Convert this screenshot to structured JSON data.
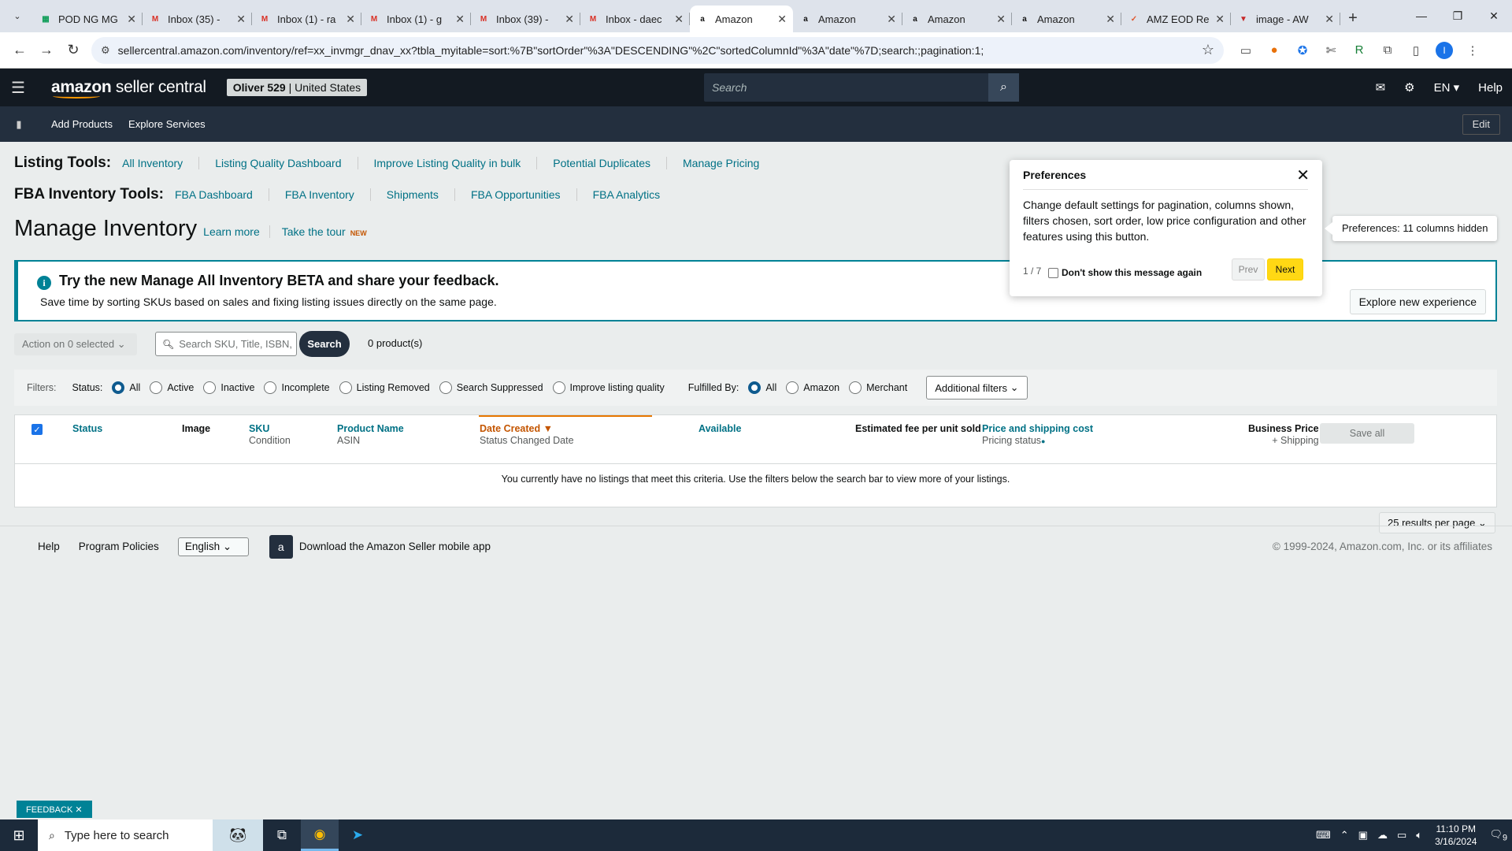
{
  "browser": {
    "tabs": [
      {
        "title": "POD NG MG",
        "favicon": "sheets-icon",
        "color": "#0f9d58",
        "glyph": "▦"
      },
      {
        "title": "Inbox (35) -",
        "favicon": "gmail-icon",
        "color": "#d93025",
        "glyph": "M"
      },
      {
        "title": "Inbox (1) - ra",
        "favicon": "gmail-icon",
        "color": "#d93025",
        "glyph": "M"
      },
      {
        "title": "Inbox (1) - g",
        "favicon": "gmail-icon",
        "color": "#d93025",
        "glyph": "M"
      },
      {
        "title": "Inbox (39) - ",
        "favicon": "gmail-icon",
        "color": "#d93025",
        "glyph": "M"
      },
      {
        "title": "Inbox - daec",
        "favicon": "gmail-icon",
        "color": "#d93025",
        "glyph": "M"
      },
      {
        "title": "Amazon",
        "favicon": "amazon-icon",
        "color": "#111111",
        "glyph": "a",
        "active": true
      },
      {
        "title": "Amazon",
        "favicon": "amazon-icon",
        "color": "#111111",
        "glyph": "a"
      },
      {
        "title": "Amazon",
        "favicon": "amazon-icon",
        "color": "#111111",
        "glyph": "a"
      },
      {
        "title": "Amazon",
        "favicon": "amazon-icon",
        "color": "#111111",
        "glyph": "a"
      },
      {
        "title": "AMZ EOD Re",
        "favicon": "zoho-icon",
        "color": "#e0572e",
        "glyph": "✓"
      },
      {
        "title": "image - AW",
        "favicon": "vivaldi-icon",
        "color": "#c62828",
        "glyph": "▼"
      }
    ],
    "url": "sellercentral.amazon.com/inventory/ref=xx_invmgr_dnav_xx?tbla_myitable=sort:%7B\"sortOrder\"%3A\"DESCENDING\"%2C\"sortedColumnId\"%3A\"date\"%7D;search:;pagination:1;",
    "profile_initial": "I"
  },
  "header": {
    "logo_amazon": "amazon",
    "logo_rest": " seller central",
    "account_name": "Oliver 529",
    "account_region": "| United States",
    "search_placeholder": "Search",
    "lang": "EN ▾",
    "help": "Help"
  },
  "subnav": {
    "add_products": "Add Products",
    "explore_services": "Explore Services",
    "edit": "Edit"
  },
  "listing_tools": {
    "label": "Listing Tools:",
    "links": [
      "All Inventory",
      "Listing Quality Dashboard",
      "Improve Listing Quality in bulk",
      "Potential Duplicates",
      "Manage Pricing"
    ]
  },
  "fba_tools": {
    "label": "FBA Inventory Tools:",
    "links": [
      "FBA Dashboard",
      "FBA Inventory",
      "Shipments",
      "FBA Opportunities",
      "FBA Analytics"
    ]
  },
  "page": {
    "title": "Manage Inventory",
    "learn_more": "Learn more",
    "take_tour": "Take the tour",
    "new_badge": "NEW"
  },
  "beta_banner": {
    "heading": "Try the new Manage All Inventory BETA and share your feedback.",
    "subtext": "Save time by sorting SKUs based on sales and fixing listing issues directly on the same page.",
    "button": "Explore new experience"
  },
  "actions": {
    "action_dropdown": "Action on 0 selected",
    "search_placeholder": "Search SKU, Title, ISBN,",
    "search_button": "Search",
    "product_count": "0 product(s)"
  },
  "filters": {
    "label": "Filters:",
    "status_label": "Status:",
    "status_options": [
      "All",
      "Active",
      "Inactive",
      "Incomplete",
      "Listing Removed",
      "Search Suppressed",
      "Improve listing quality"
    ],
    "fulfilled_label": "Fulfilled By:",
    "fulfilled_options": [
      "All",
      "Amazon",
      "Merchant"
    ],
    "additional": "Additional filters"
  },
  "table": {
    "col_status": "Status",
    "col_image": "Image",
    "col_sku": "SKU",
    "col_condition": "Condition",
    "col_product_name": "Product Name",
    "col_asin": "ASIN",
    "col_date_created": "Date Created",
    "col_status_changed": "Status Changed Date",
    "col_available": "Available",
    "col_fee": "Estimated fee per unit sold",
    "col_price": "Price and shipping cost",
    "col_pricing_status": "Pricing status",
    "col_business_price": "Business Price",
    "col_shipping": "+ Shipping",
    "save_all": "Save all",
    "empty_message": "You currently have no listings that meet this criteria. Use the filters below the search bar to view more of your listings."
  },
  "pagination": {
    "results_per_page": "25 results per page"
  },
  "footer": {
    "help": "Help",
    "policies": "Program Policies",
    "language": "English",
    "app": "Download the Amazon Seller mobile app",
    "copyright": "© 1999-2024, Amazon.com, Inc. or its affiliates"
  },
  "preferences_popup": {
    "title": "Preferences",
    "body": "Change default settings for pagination, columns shown, filters chosen, sort order, low price configuration and other features using this button.",
    "step": "1 / 7",
    "dont_show": "Don't show this message again",
    "prev": "Prev",
    "next": "Next"
  },
  "tooltip": "Preferences: 11 columns hidden",
  "feedback": "FEEDBACK ✕",
  "taskbar": {
    "search_placeholder": "Type here to search",
    "time": "11:10 PM",
    "date": "3/16/2024",
    "notif_count": "9"
  }
}
